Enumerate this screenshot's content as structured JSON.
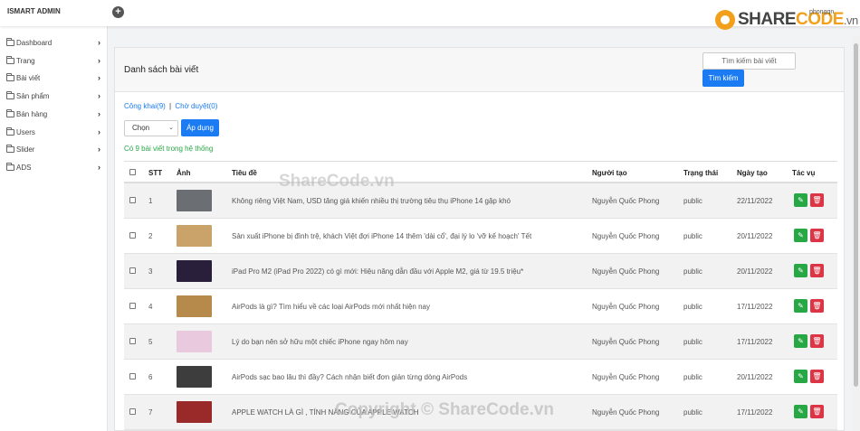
{
  "app": {
    "brand": "ISMART ADMIN",
    "user": "phongqn",
    "logo": {
      "part1": "SHARE",
      "part2": "CODE",
      "suffix": ".vn"
    }
  },
  "sidebar": {
    "items": [
      {
        "label": "Dashboard"
      },
      {
        "label": "Trang"
      },
      {
        "label": "Bài viết"
      },
      {
        "label": "Sản phẩm"
      },
      {
        "label": "Bán hàng"
      },
      {
        "label": "Users"
      },
      {
        "label": "Slider"
      },
      {
        "label": "ADS"
      }
    ]
  },
  "main": {
    "title": "Danh sách bài viết",
    "search": {
      "placeholder": "Tìm kiếm bài viết",
      "button": "Tìm kiếm"
    },
    "filters": {
      "published": "Công khai(9)",
      "separator": "|",
      "pending": "Chờ duyệt(0)"
    },
    "bulk": {
      "selected": "Chọn",
      "apply": "Áp dụng"
    },
    "count_text": "Có 9 bài viết trong hệ thống",
    "columns": [
      "STT",
      "Ảnh",
      "Tiêu đề",
      "Người tạo",
      "Trạng thái",
      "Ngày tạo",
      "Tác vụ"
    ],
    "rows": [
      {
        "stt": "1",
        "title": "Không riêng Việt Nam, USD tăng giá khiến nhiều thị trường tiêu thụ iPhone 14 gặp khó",
        "author": "Nguyễn Quốc Phong",
        "status": "public",
        "date": "22/11/2022",
        "thumb_color": "#6b6f74"
      },
      {
        "stt": "2",
        "title": "Sản xuất iPhone bị đình trệ, khách Việt đợi iPhone 14 thêm 'dài cổ', đại lý lo 'vỡ kế hoạch' Tết",
        "author": "Nguyễn Quốc Phong",
        "status": "public",
        "date": "20/11/2022",
        "thumb_color": "#c9a36a"
      },
      {
        "stt": "3",
        "title": "iPad Pro M2 (iPad Pro 2022) có gì mới: Hiệu năng dẫn đầu với Apple M2, giá từ 19.5 triệu*",
        "author": "Nguyễn Quốc Phong",
        "status": "public",
        "date": "20/11/2022",
        "thumb_color": "#2a1f3a"
      },
      {
        "stt": "4",
        "title": "AirPods là gì? Tìm hiểu về các loại AirPods mới nhất hiện nay",
        "author": "Nguyễn Quốc Phong",
        "status": "public",
        "date": "17/11/2022",
        "thumb_color": "#b58a4a"
      },
      {
        "stt": "5",
        "title": "Lý do bạn nên sở hữu một chiếc iPhone ngay hôm nay",
        "author": "Nguyễn Quốc Phong",
        "status": "public",
        "date": "17/11/2022",
        "thumb_color": "#e8c9dd"
      },
      {
        "stt": "6",
        "title": "AirPods sạc bao lâu thì đầy? Cách nhận biết đơn giản từng dòng AirPods",
        "author": "Nguyễn Quốc Phong",
        "status": "public",
        "date": "20/11/2022",
        "thumb_color": "#3d3d3d"
      },
      {
        "stt": "7",
        "title": "APPLE WATCH LÀ GÌ , TÍNH NĂNG CỦA APPLE WATCH",
        "author": "Nguyễn Quốc Phong",
        "status": "public",
        "date": "17/11/2022",
        "thumb_color": "#9a2a2a"
      }
    ]
  },
  "watermark": {
    "center": "ShareCode.vn",
    "bottom": "Copyright © ShareCode.vn"
  },
  "colors": {
    "primary": "#1a7bf2",
    "success": "#28a745",
    "danger": "#dc3545",
    "accent": "#f2a01c"
  }
}
